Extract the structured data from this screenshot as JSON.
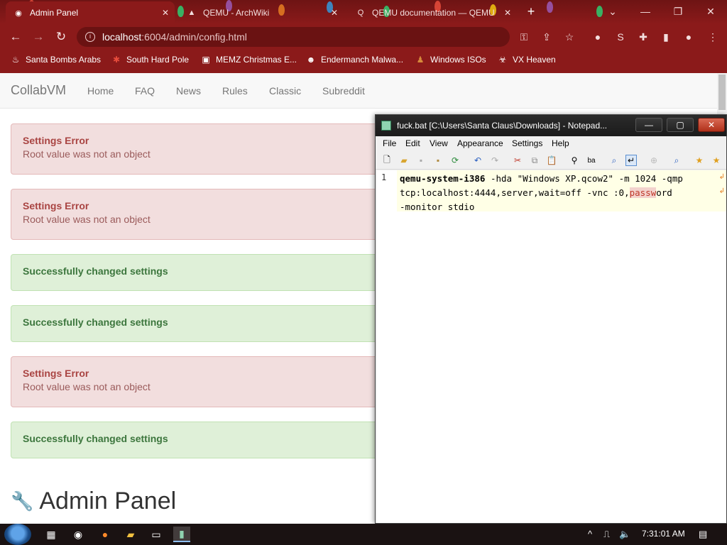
{
  "browser": {
    "tabs": [
      {
        "title": "Admin Panel",
        "icon": "chrome-icon"
      },
      {
        "title": "QEMU - ArchWiki",
        "icon": "archwiki-icon"
      },
      {
        "title": "QEMU documentation — QEMU",
        "icon": "qemu-icon"
      }
    ],
    "url_host": "localhost",
    "url_rest": ":6004/admin/config.html",
    "bookmarks": [
      {
        "label": "Santa Bombs Arabs",
        "icon": "fire-icon"
      },
      {
        "label": "South Hard Pole",
        "icon": "snowflake-icon"
      },
      {
        "label": "MEMZ Christmas E...",
        "icon": "window-icon"
      },
      {
        "label": "Endermanch Malwa...",
        "icon": "raccoon-icon"
      },
      {
        "label": "Windows ISOs",
        "icon": "gingerbread-icon"
      },
      {
        "label": "VX Heaven",
        "icon": "biohazard-icon"
      }
    ]
  },
  "site": {
    "brand": "CollabVM",
    "nav": [
      "Home",
      "FAQ",
      "News",
      "Rules",
      "Classic",
      "Subreddit"
    ],
    "alerts": [
      {
        "type": "error",
        "title": "Settings Error",
        "message": "Root value was not an object"
      },
      {
        "type": "error",
        "title": "Settings Error",
        "message": "Root value was not an object"
      },
      {
        "type": "success",
        "title": "Successfully changed settings"
      },
      {
        "type": "success",
        "title": "Successfully changed settings"
      },
      {
        "type": "error",
        "title": "Settings Error",
        "message": "Root value was not an object"
      },
      {
        "type": "success",
        "title": "Successfully changed settings"
      }
    ],
    "heading": "Admin Panel"
  },
  "notepad": {
    "title": "fuck.bat [C:\\Users\\Santa Claus\\Downloads] - Notepad...",
    "menu": [
      "File",
      "Edit",
      "View",
      "Appearance",
      "Settings",
      "Help"
    ],
    "line_number": "1",
    "code_cmd": "qemu-system-i386",
    "code_line1": " -hda \"Windows XP.qcow2\" -m 1024 -qmp",
    "code_line2a": "tcp:localhost:4444,server,wait=off -vnc :0,",
    "code_line2_hl": "passw",
    "code_line2b": "ord",
    "code_line3": "-monitor stdio"
  },
  "taskbar": {
    "clock": "7:31:01 AM"
  },
  "colors": {
    "chrome_bar": "#8b1a1a",
    "error_bg": "#f2dede",
    "success_bg": "#dff0d8",
    "editor_line_bg": "#ffffe6"
  }
}
